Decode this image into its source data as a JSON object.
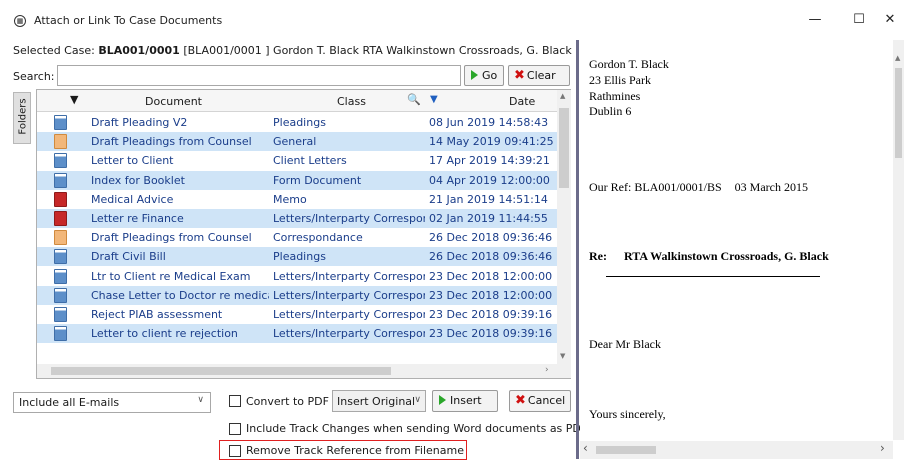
{
  "window": {
    "title": "Attach or Link To Case Documents",
    "minimize": "—",
    "maximize": "☐",
    "close": "✕"
  },
  "selected_case": {
    "label": "Selected Case:",
    "case_id": "BLA001/0001",
    "detail": "[BLA001/0001 ] Gordon T. Black RTA Walkinstown Crossroads, G. Black"
  },
  "search": {
    "label": "Search:",
    "value": "",
    "go_label": "Go",
    "clear_label": "Clear"
  },
  "folders_tab": "Folders",
  "grid": {
    "columns": {
      "document": "Document",
      "class": "Class",
      "date": "Date"
    },
    "rows": [
      {
        "icon": "word-doc-icon",
        "document": "Draft Pleading V2",
        "class": "Pleadings",
        "date": "08 Jun 2019 14:58:43"
      },
      {
        "icon": "note-icon",
        "document": "Draft Pleadings from Counsel",
        "class": "General",
        "date": "14 May 2019 09:41:25"
      },
      {
        "icon": "word-doc-icon",
        "document": "Letter to Client",
        "class": "Client Letters",
        "date": "17 Apr 2019 14:39:21"
      },
      {
        "icon": "word-doc-icon",
        "document": "Index for Booklet",
        "class": "Form Document",
        "date": "04 Apr 2019 12:00:00"
      },
      {
        "icon": "memo-icon",
        "document": "Medical Advice",
        "class": "Memo",
        "date": "21 Jan 2019 14:51:14"
      },
      {
        "icon": "memo-icon",
        "document": "Letter re Finance",
        "class": "Letters/Interparty Correspon",
        "date": "02 Jan 2019 11:44:55"
      },
      {
        "icon": "note-icon",
        "document": "Draft Pleadings from Counsel",
        "class": "Correspondance",
        "date": "26 Dec 2018 09:36:46"
      },
      {
        "icon": "word-doc-icon",
        "document": "Draft Civil Bill",
        "class": "Pleadings",
        "date": "26 Dec 2018 09:36:46"
      },
      {
        "icon": "word-doc-icon",
        "document": "Ltr to Client re Medical Exam",
        "class": "Letters/Interparty Correspon",
        "date": "23 Dec 2018 12:00:00"
      },
      {
        "icon": "word-doc-icon",
        "document": "Chase Letter to Doctor re medica",
        "class": "Letters/Interparty Correspon",
        "date": "23 Dec 2018 12:00:00"
      },
      {
        "icon": "word-doc-icon",
        "document": "Reject PIAB assessment",
        "class": "Letters/Interparty Correspon",
        "date": "23 Dec 2018 09:39:16"
      },
      {
        "icon": "word-doc-icon",
        "document": "Letter to client re rejection",
        "class": "Letters/Interparty Correspon",
        "date": "23 Dec 2018 09:39:16"
      }
    ]
  },
  "bottom": {
    "email_filter": "Include all E-mails",
    "convert_pdf": "Convert to PDF",
    "insert_mode": "Insert Original",
    "insert_label": "Insert",
    "cancel_label": "Cancel",
    "track_changes": "Include Track Changes when sending Word documents as PDF",
    "remove_track": "Remove Track Reference from Filename"
  },
  "preview": {
    "address": [
      "Gordon T. Black",
      "23 Ellis Park",
      "Rathmines",
      "Dublin 6"
    ],
    "our_ref": "Our Ref: BLA001/0001/BS",
    "date": "03 March 2015",
    "re_label": "Re:",
    "re_text": "RTA Walkinstown Crossroads, G. Black",
    "greeting": "Dear Mr Black",
    "closing": "Yours sincerely,"
  },
  "colors": {
    "row_highlight": "#cfe4f7",
    "link_text": "#1a3d8a",
    "go_green": "#2aa62a",
    "clear_red": "#d01010",
    "highlight_box": "#e02020"
  }
}
